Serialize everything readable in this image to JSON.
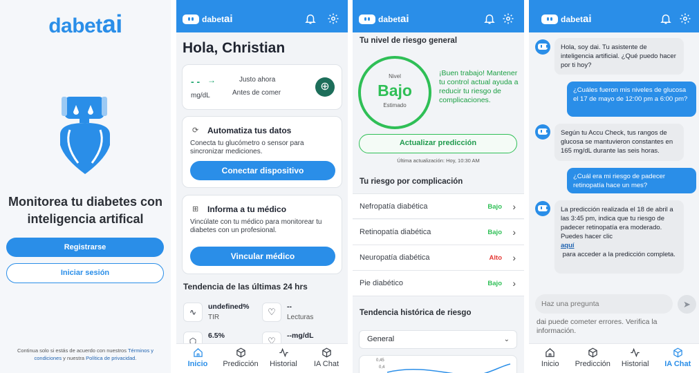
{
  "brand": {
    "prefix": "dabet",
    "suffix": "ai"
  },
  "welcome": {
    "title": "Monitorea tu diabetes con inteligencia artifical",
    "register_label": "Registrarse",
    "login_label": "Iniciar sesión",
    "legal_prefix": "Continua solo si estás de acuerdo con nuestros ",
    "legal_terms": "Términos y condiciones",
    "legal_mid": " y nuestra ",
    "legal_privacy": "Política de privacidad",
    "legal_end": "."
  },
  "home": {
    "greeting": "Hola, Christian",
    "glucose": {
      "value": "- -",
      "arrow": "→",
      "unit": "mg/dL",
      "time": "Justo ahora",
      "context": "Antes de comer"
    },
    "automate": {
      "title": "Automatiza tus datos",
      "body": "Conecta tu glucómetro o sensor para sincronizar mediciones.",
      "button": "Conectar dispositivo"
    },
    "doctor": {
      "title": "Informa a tu médico",
      "body": "Vincúlate con tu médico para monitorear tu diabetes con un profesional.",
      "button": "Vincular médico"
    },
    "trend_title": "Tendencia de las últimas 24 hrs",
    "stats": [
      {
        "value": "undefined%",
        "label": "TIR"
      },
      {
        "value": "--",
        "label": "Lecturas"
      },
      {
        "value": "6.5%",
        "label": ""
      },
      {
        "value": "--mg/dL",
        "label": ""
      }
    ]
  },
  "tabs": [
    {
      "label": "Inicio",
      "icon": "home-icon"
    },
    {
      "label": "Predicción",
      "icon": "cube-icon"
    },
    {
      "label": "Historial",
      "icon": "pulse-icon"
    },
    {
      "label": "IA Chat",
      "icon": "chat-icon"
    }
  ],
  "risk": {
    "title": "Tu nivel de riesgo general",
    "circle_top": "Nivel",
    "level": "Bajo",
    "circle_bottom": "Estimado",
    "message": "¡Buen trabajo! Mantener tu control actual ayuda a reducir tu riesgo de complicaciones.",
    "update_label": "Actualizar predicción",
    "last_update": "Última actualización: Hoy, 10:30 AM",
    "complications_title": "Tu riesgo por complicación",
    "complications": [
      {
        "name": "Nefropatía diabética",
        "level": "Bajo"
      },
      {
        "name": "Retinopatía diabética",
        "level": "Bajo"
      },
      {
        "name": "Neuropatía diabética",
        "level": "Alto"
      },
      {
        "name": "Pie diabético",
        "level": "Bajo"
      }
    ],
    "history_title": "Tendencia histórica de riesgo",
    "history_select": "General",
    "chart_ticks": [
      "0,45",
      "0,4"
    ]
  },
  "chat": {
    "messages": [
      {
        "from": "bot",
        "text": "Hola, soy dai. Tu asistente de inteligencia artificial. ¿Qué puedo hacer por ti hoy?"
      },
      {
        "from": "user",
        "text": "¿Cuáles fueron mis niveles de glucosa el 17 de mayo de 12:00 pm a 6:00 pm?"
      },
      {
        "from": "bot",
        "text": "Según tu Accu Check, tus rangos de glucosa se mantuvieron constantes en 165 mg/dL durante las seis horas."
      },
      {
        "from": "user",
        "text": "¿Cuál era mi riesgo de padecer retinopatía hace un mes?"
      },
      {
        "from": "bot",
        "text_before": "La predicción realizada el 18 de abril a las 3:45 pm, indica que tu riesgo de padecer retinopatía era moderado. Puedes hacer clic",
        "link": "aquí",
        "text_after": "para acceder a la predicción completa."
      }
    ],
    "input_placeholder": "Haz una pregunta",
    "disclaimer": "dai puede cometer errores. Verifica la información."
  },
  "colors": {
    "primary": "#2a8ee8",
    "low": "#2fbf56",
    "high": "#e53935"
  }
}
